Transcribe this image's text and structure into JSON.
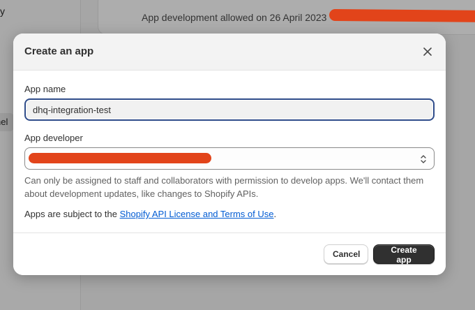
{
  "background": {
    "sidebar_fragment": "y",
    "sidebar_item_fragment": "nel",
    "notice_text": "App development allowed on 26 April 2023"
  },
  "modal": {
    "title": "Create an app",
    "close_icon": "close-icon",
    "app_name": {
      "label": "App name",
      "value": "dhq-integration-test"
    },
    "app_developer": {
      "label": "App developer",
      "value": "",
      "chevron_icon": "select-chevron-icon"
    },
    "help_text": "Can only be assigned to staff and collaborators with permission to develop apps. We'll contact them about development updates, like changes to Shopify APIs.",
    "terms": {
      "prefix": "Apps are subject to the ",
      "link_label": "Shopify API License and Terms of Use",
      "suffix": "."
    },
    "footer": {
      "cancel_label": "Cancel",
      "create_label": "Create app"
    }
  },
  "colors": {
    "primary_button": "#303030",
    "link": "#005bd3",
    "focus_border": "#2f4c8a",
    "redaction": "#e2441a"
  }
}
